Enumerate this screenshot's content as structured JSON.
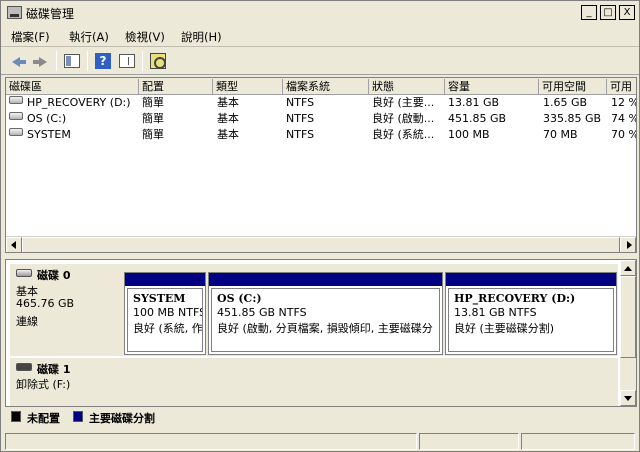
{
  "window": {
    "title": "磁碟管理"
  },
  "window_controls": {
    "minimize": "_",
    "maximize": "□",
    "close": "X"
  },
  "menu": [
    "檔案(F)",
    "執行(A)",
    "檢視(V)",
    "說明(H)"
  ],
  "toolbar": {
    "help_glyph": "?"
  },
  "volume_list": {
    "columns": [
      "磁碟區",
      "配置",
      "類型",
      "檔案系統",
      "狀態",
      "容量",
      "可用空間",
      "可用"
    ],
    "rows": [
      {
        "name": "HP_RECOVERY (D:)",
        "layout": "簡單",
        "type": "基本",
        "fs": "NTFS",
        "status": "良好 (主要...",
        "capacity": "13.81 GB",
        "free": "1.65 GB",
        "pct": "12 %"
      },
      {
        "name": "OS (C:)",
        "layout": "簡單",
        "type": "基本",
        "fs": "NTFS",
        "status": "良好 (啟動...",
        "capacity": "451.85 GB",
        "free": "335.85 GB",
        "pct": "74 %"
      },
      {
        "name": "SYSTEM",
        "layout": "簡單",
        "type": "基本",
        "fs": "NTFS",
        "status": "良好 (系統...",
        "capacity": "100 MB",
        "free": "70 MB",
        "pct": "70 %"
      }
    ]
  },
  "disks": [
    {
      "label": "磁碟 0",
      "kind": "基本",
      "size": "465.76 GB",
      "state": "連線",
      "partitions": [
        {
          "name": "SYSTEM",
          "size": "100 MB NTFS",
          "status": "良好 (系統, 作"
        },
        {
          "name": "OS  (C:)",
          "size": "451.85 GB NTFS",
          "status": "良好 (啟動, 分頁檔案, 損毀傾印, 主要磁碟分"
        },
        {
          "name": "HP_RECOVERY  (D:)",
          "size": "13.81 GB NTFS",
          "status": "良好 (主要磁碟分割)"
        }
      ]
    },
    {
      "label": "磁碟 1",
      "kind": "卸除式 (F:)"
    }
  ],
  "legend": [
    {
      "label": "未配置",
      "color": "#000000"
    },
    {
      "label": "主要磁碟分割",
      "color": "#000080"
    }
  ]
}
